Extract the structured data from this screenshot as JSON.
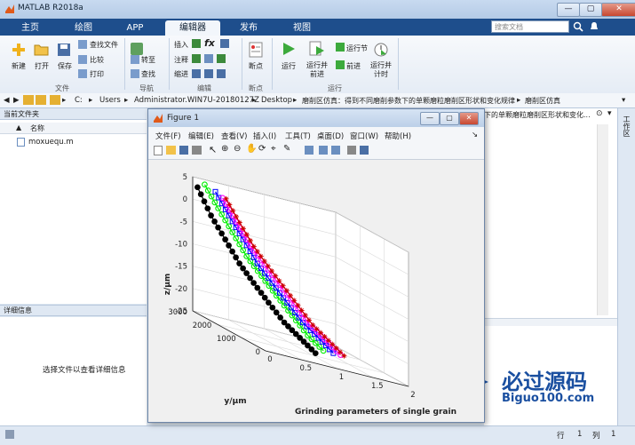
{
  "window": {
    "title": "MATLAB R2018a",
    "close_label": "✕",
    "min_label": "—",
    "max_label": "▢"
  },
  "tabs": [
    "主页",
    "绘图",
    "APP",
    "编辑器",
    "发布",
    "视图"
  ],
  "search_placeholder": "搜索文档",
  "ribbon": {
    "file_group": {
      "new": "新建",
      "open": "打开",
      "save": "保存",
      "find_files": "查找文件",
      "compare": "比较",
      "print": "打印",
      "label": "文件"
    },
    "nav_group": {
      "goto": "转至",
      "find": "查找",
      "label": "导航"
    },
    "edit_group": {
      "insert": "插入",
      "comment": "注释",
      "indent": "缩进",
      "label": "编辑"
    },
    "breakpoint_group": {
      "breakpoints": "断点",
      "label": "断点"
    },
    "run_group": {
      "run": "运行",
      "run_advance": "运行并\n前进",
      "run_section": "运行节",
      "advance": "前进",
      "run_time": "运行并\n计时",
      "label": "运行"
    }
  },
  "address": {
    "parts": [
      "C:",
      "Users",
      "Administrator.WIN7U-20180127Z",
      "Desktop",
      "磨削区仿真：得到不同磨削参数下的单颗磨粒磨削区形状和变化规律",
      "磨削区仿真"
    ],
    "overflow_text": "下的单颗磨粒磨削区形状和变化..."
  },
  "left_panel": {
    "title": "当前文件夹",
    "column_name": "名称",
    "sort_arrow": "▲",
    "files": [
      "moxuequ.m"
    ],
    "details_title": "详细信息",
    "details_hint": "选择文件以查看详细信息"
  },
  "side_strip_label": "工作区",
  "status": {
    "row_label": "行",
    "row_value": "1",
    "col_label": "列",
    "col_value": "1"
  },
  "figure": {
    "title": "Figure 1",
    "menu": [
      "文件(F)",
      "编辑(E)",
      "查看(V)",
      "插入(I)",
      "工具(T)",
      "桌面(D)",
      "窗口(W)",
      "帮助(H)"
    ]
  },
  "watermark": {
    "text": "必过源码",
    "url": "Biguo100.com"
  },
  "chart_data": {
    "type": "scatter",
    "title": "",
    "xlabel": "Grinding parameters of single grain",
    "ylabel": "y/μm",
    "zlabel": "z/μm",
    "xlim": [
      0,
      2
    ],
    "ylim": [
      0,
      3000
    ],
    "zlim": [
      -25,
      5
    ],
    "xticks": [
      "0",
      "0.5",
      "1",
      "1.5",
      "2"
    ],
    "yticks": [
      "0",
      "1000",
      "2000",
      "3000"
    ],
    "zticks": [
      "5",
      "0",
      "-5",
      "-10",
      "-15",
      "-20",
      "-25"
    ],
    "grid": true,
    "series": [
      {
        "color": "#000000",
        "marker": "circle",
        "x": [
          0.05,
          0.12,
          0.2,
          0.28,
          0.36,
          0.45,
          0.55,
          0.65,
          0.75
        ],
        "y": [
          2950,
          2600,
          2250,
          1900,
          1550,
          1200,
          850,
          500,
          150
        ],
        "z": [
          3,
          -2,
          -6,
          -10,
          -13,
          -16,
          -19,
          -21,
          -23
        ]
      },
      {
        "color": "#00ee00",
        "marker": "circle",
        "x": [
          0.15,
          0.22,
          0.3,
          0.38,
          0.47,
          0.56,
          0.66,
          0.76,
          0.86
        ],
        "y": [
          2950,
          2600,
          2250,
          1900,
          1550,
          1200,
          850,
          500,
          150
        ],
        "z": [
          4,
          0,
          -4,
          -8,
          -11,
          -14,
          -17,
          -20,
          -22
        ]
      },
      {
        "color": "#0000ff",
        "marker": "square",
        "x": [
          0.3,
          0.37,
          0.45,
          0.53,
          0.62,
          0.71,
          0.81,
          0.91,
          1.0
        ],
        "y": [
          2950,
          2600,
          2250,
          1900,
          1550,
          1200,
          850,
          500,
          150
        ],
        "z": [
          3,
          -1,
          -5,
          -9,
          -12,
          -15,
          -18,
          -20,
          -22
        ]
      },
      {
        "color": "#ff00ff",
        "marker": "circle",
        "x": [
          0.4,
          0.47,
          0.55,
          0.63,
          0.72,
          0.81,
          0.9,
          1.0,
          1.1
        ],
        "y": [
          2950,
          2600,
          2250,
          1900,
          1550,
          1200,
          850,
          500,
          150
        ],
        "z": [
          2,
          -2,
          -6,
          -9,
          -12,
          -15,
          -18,
          -20,
          -22
        ]
      },
      {
        "color": "#cc0000",
        "marker": "star",
        "x": [
          0.45,
          0.52,
          0.6,
          0.68,
          0.77,
          0.86,
          0.95,
          1.05,
          1.15
        ],
        "y": [
          2950,
          2600,
          2250,
          1900,
          1550,
          1200,
          850,
          500,
          150
        ],
        "z": [
          2,
          -2,
          -6,
          -9,
          -12,
          -15,
          -18,
          -20,
          -22
        ]
      }
    ]
  }
}
